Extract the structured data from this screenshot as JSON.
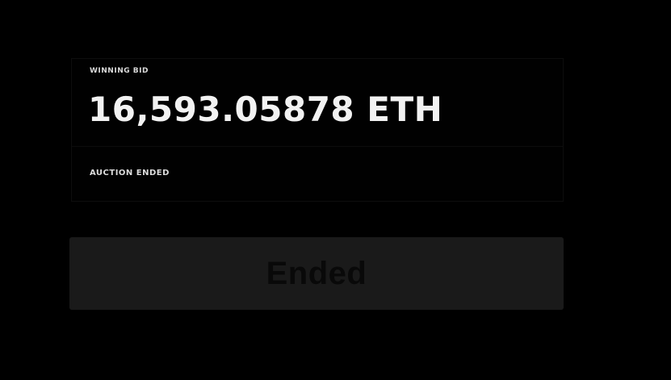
{
  "auction": {
    "winning_bid_label": "WINNING BID",
    "winning_bid_amount": "16,593.05878 ETH",
    "status_text": "AUCTION ENDED"
  },
  "action_button": {
    "label": "Ended",
    "disabled": true
  },
  "colors": {
    "background": "#000000",
    "text_primary": "#f2f2f2",
    "button_background": "#1a1a1a",
    "button_text": "#090909"
  }
}
